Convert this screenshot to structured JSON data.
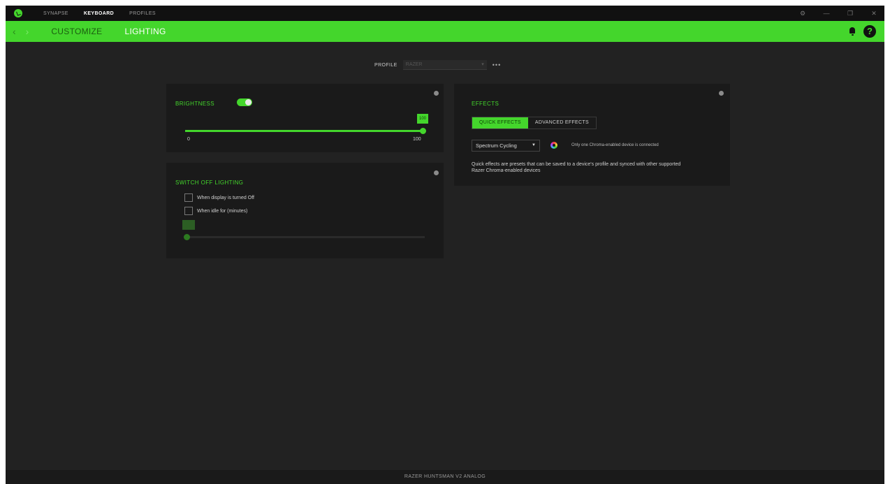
{
  "top_tabs": [
    "SYNAPSE",
    "KEYBOARD",
    "PROFILES"
  ],
  "window_controls": [
    "⚙",
    "—",
    "❐",
    "✕"
  ],
  "nav": {
    "back_icon": "‹",
    "forward_icon": "›",
    "tabs": [
      "CUSTOMIZE",
      "LIGHTING"
    ],
    "help_label": "?"
  },
  "profile": {
    "label": "PROFILE",
    "selected": "RAZER",
    "more_label": "•••"
  },
  "brightness": {
    "title": "BRIGHTNESS",
    "enabled": true,
    "value": "100",
    "min_label": "0",
    "max_label": "100",
    "level": 1.0
  },
  "switch_off": {
    "title": "SWITCH OFF LIGHTING",
    "options": [
      "When display is turned Off",
      "When idle for (minutes)"
    ],
    "idle_level": 0.0
  },
  "effects": {
    "title": "EFFECTS",
    "tabs": [
      "QUICK EFFECTS",
      "ADVANCED EFFECTS"
    ],
    "selected_effect": "Spectrum Cycling",
    "note": "Only one Chroma-enabled device is connected",
    "description": "Quick effects are presets that can be saved to a device's profile and synced with other supported Razer Chroma-enabled devices"
  },
  "status_bar": "RAZER HUNTSMAN V2 ANALOG",
  "colors": {
    "accent": "#44d62c",
    "background": "#222222",
    "panel": "#1a1a1a"
  },
  "icons": [
    "razer-logo-icon",
    "settings-icon",
    "minimize-icon",
    "maximize-icon",
    "close-icon",
    "back-arrow-icon",
    "forward-arrow-icon",
    "bell-icon",
    "help-icon",
    "info-icon",
    "chroma-icon",
    "chevron-down-icon"
  ]
}
